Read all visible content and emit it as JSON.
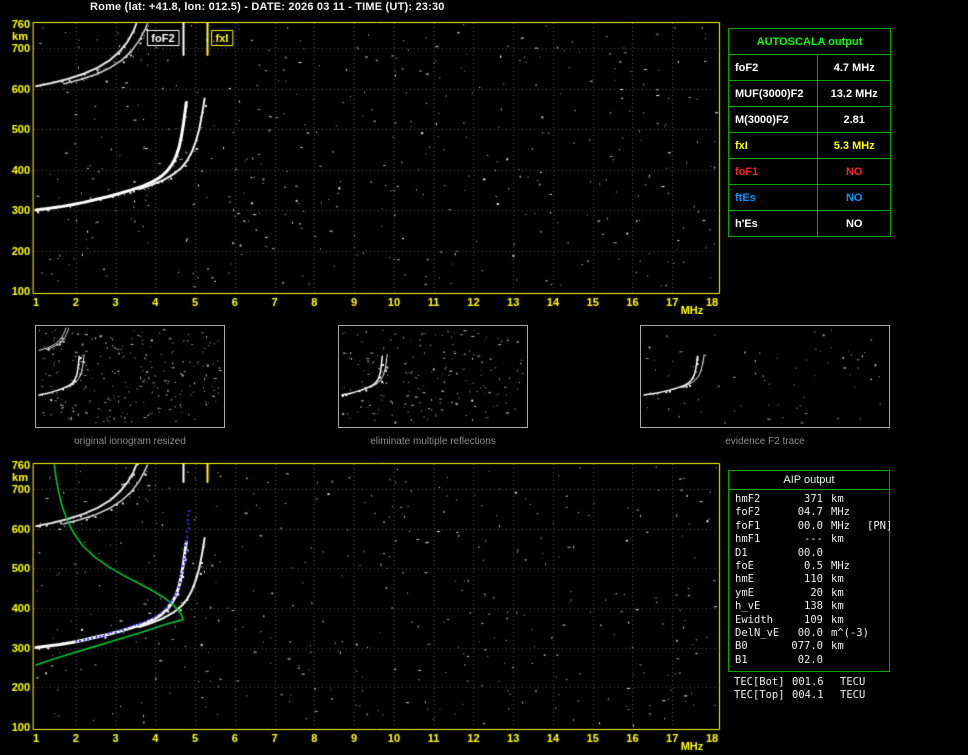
{
  "title": "Rome (lat: +41.8, lon: 012.5) - DATE: 2026 03 11 - TIME (UT): 23:30",
  "colors": {
    "background": "#000000",
    "axis": "#ffff00",
    "plot_border": "#ffff00",
    "grid": "#4f4f4f",
    "trace": "#ffffff",
    "profile_green": "#00c432",
    "fit_blue": "#3333e6",
    "table_border": "#00a800",
    "header_green": "#00ff00",
    "caption_gray": "#8c8c8c"
  },
  "autoscala_table": {
    "header": "AUTOSCALA output",
    "rows": [
      {
        "label": "foF2",
        "value": "4.7 MHz",
        "color": "#ffffff"
      },
      {
        "label": "MUF(3000)F2",
        "value": "13.2 MHz",
        "color": "#ffffff"
      },
      {
        "label": "M(3000)F2",
        "value": "2.81",
        "color": "#ffffff"
      },
      {
        "label": "fxI",
        "value": "5.3 MHz",
        "color": "#ffff00"
      },
      {
        "label": "foF1",
        "value": "NO",
        "color": "#ff2020"
      },
      {
        "label": "ftEs",
        "value": "NO",
        "color": "#0096ff"
      },
      {
        "label": "h'Es",
        "value": "NO",
        "color": "#ffffff"
      }
    ]
  },
  "aip_table": {
    "header": "AIP output",
    "rows": [
      {
        "label": "hmF2",
        "value": "371",
        "unit": "km",
        "extra": ""
      },
      {
        "label": "foF2",
        "value": "04.7",
        "unit": "MHz",
        "extra": ""
      },
      {
        "label": "foF1",
        "value": "00.0",
        "unit": "MHz",
        "extra": "[PN]"
      },
      {
        "label": "hmF1",
        "value": "---",
        "unit": "km",
        "extra": ""
      },
      {
        "label": "D1",
        "value": "00.0",
        "unit": "",
        "extra": ""
      },
      {
        "label": "foE",
        "value": "0.5",
        "unit": "MHz",
        "extra": ""
      },
      {
        "label": "hmE",
        "value": "110",
        "unit": "km",
        "extra": ""
      },
      {
        "label": "ymE",
        "value": "20",
        "unit": "km",
        "extra": ""
      },
      {
        "label": "h_vE",
        "value": "138",
        "unit": "km",
        "extra": ""
      },
      {
        "label": "Ewidth",
        "value": "109",
        "unit": "km",
        "extra": ""
      },
      {
        "label": "DelN_vE",
        "value": "00.0",
        "unit": "m^(-3)",
        "extra": ""
      },
      {
        "label": "B0",
        "value": "077.0",
        "unit": "km",
        "extra": ""
      },
      {
        "label": "B1",
        "value": "02.0",
        "unit": "",
        "extra": ""
      }
    ],
    "tec_rows": [
      {
        "label": "TEC[Bot]",
        "value": "001.6",
        "unit": "TECU"
      },
      {
        "label": "TEC[Top]",
        "value": "004.1",
        "unit": "TECU"
      }
    ]
  },
  "thumbnails": [
    {
      "caption": "original ionogram resized",
      "series_indices": [
        0,
        1,
        2,
        3
      ],
      "noise_count": 260,
      "noise_seed": 21
    },
    {
      "caption": "eliminate multiple reflections",
      "series_indices": [
        0,
        1
      ],
      "noise_count": 190,
      "noise_seed": 22
    },
    {
      "caption": "evidence F2 trace",
      "series_indices": [
        0,
        1
      ],
      "noise_count": 70,
      "noise_seed": 23
    }
  ],
  "chart_data": [
    {
      "type": "scatter",
      "title": "ionogram with autoscaled characteristics",
      "xlabel": "MHz",
      "ylabel": "km",
      "xlim": [
        1,
        18
      ],
      "ylim": [
        100,
        760
      ],
      "xticks": [
        1,
        2,
        3,
        4,
        5,
        6,
        7,
        8,
        9,
        10,
        11,
        12,
        13,
        14,
        15,
        16,
        17,
        18
      ],
      "yticks": [
        100,
        200,
        300,
        400,
        500,
        600,
        700,
        760
      ],
      "grid": true,
      "legend": false,
      "markers": [
        {
          "label": "foF2",
          "x": 4.7,
          "color": "#ffffff",
          "side": "left"
        },
        {
          "label": "fxI",
          "x": 5.3,
          "color": "#ffff00",
          "side": "right"
        }
      ],
      "noise": {
        "seed": 11,
        "count": 430
      },
      "series": [
        {
          "name": "F2-trace-o-mode",
          "color": "#ffffff",
          "style": "trace",
          "width": 3,
          "points": [
            [
              1.0,
              300
            ],
            [
              1.3,
              304
            ],
            [
              1.6,
              308
            ],
            [
              1.9,
              313
            ],
            [
              2.2,
              319
            ],
            [
              2.5,
              326
            ],
            [
              2.8,
              333
            ],
            [
              3.1,
              341
            ],
            [
              3.4,
              350
            ],
            [
              3.7,
              360
            ],
            [
              3.95,
              371
            ],
            [
              4.15,
              383
            ],
            [
              4.3,
              397
            ],
            [
              4.42,
              413
            ],
            [
              4.52,
              432
            ],
            [
              4.6,
              456
            ],
            [
              4.66,
              484
            ],
            [
              4.71,
              514
            ],
            [
              4.75,
              544
            ],
            [
              4.78,
              566
            ]
          ]
        },
        {
          "name": "F2-trace-x-mode",
          "color": "#f2f2f2",
          "style": "trace",
          "width": 2,
          "points": [
            [
              3.6,
              352
            ],
            [
              3.9,
              362
            ],
            [
              4.2,
              374
            ],
            [
              4.45,
              388
            ],
            [
              4.65,
              404
            ],
            [
              4.8,
              422
            ],
            [
              4.92,
              444
            ],
            [
              5.02,
              470
            ],
            [
              5.1,
              498
            ],
            [
              5.16,
              528
            ],
            [
              5.21,
              556
            ],
            [
              5.24,
              576
            ]
          ]
        },
        {
          "name": "second-hop-trace",
          "color": "#e6e6e6",
          "style": "trace",
          "width": 2,
          "points": [
            [
              1.0,
              606
            ],
            [
              1.4,
              614
            ],
            [
              1.8,
              624
            ],
            [
              2.2,
              637
            ],
            [
              2.55,
              652
            ],
            [
              2.85,
              670
            ],
            [
              3.1,
              692
            ],
            [
              3.3,
              716
            ],
            [
              3.45,
              742
            ],
            [
              3.52,
              760
            ]
          ]
        },
        {
          "name": "second-hop-trace-x",
          "color": "#d8d8d8",
          "style": "trace",
          "width": 1.5,
          "points": [
            [
              1.7,
              612
            ],
            [
              2.1,
              622
            ],
            [
              2.5,
              635
            ],
            [
              2.85,
              651
            ],
            [
              3.15,
              670
            ],
            [
              3.4,
              693
            ],
            [
              3.6,
              720
            ],
            [
              3.75,
              748
            ],
            [
              3.8,
              760
            ]
          ]
        }
      ]
    },
    {
      "type": "scatter",
      "title": "restored ionogram with electron density profile and fitted F2 trace",
      "xlabel": "MHz",
      "ylabel": "km",
      "xlim": [
        1,
        18
      ],
      "ylim": [
        100,
        760
      ],
      "xticks": [
        1,
        2,
        3,
        4,
        5,
        6,
        7,
        8,
        9,
        10,
        11,
        12,
        13,
        14,
        15,
        16,
        17,
        18
      ],
      "yticks": [
        100,
        200,
        300,
        400,
        500,
        600,
        700,
        760
      ],
      "grid": true,
      "legend": false,
      "markers": [
        {
          "label": "",
          "x": 4.7,
          "color": "#ffffff",
          "side": "left"
        },
        {
          "label": "",
          "x": 5.3,
          "color": "#ffff00",
          "side": "right"
        }
      ],
      "noise": {
        "seed": 17,
        "count": 400
      },
      "series": [
        {
          "name": "F2-trace-o-mode",
          "color": "#ffffff",
          "style": "trace",
          "width": 3,
          "points": [
            [
              1.0,
              300
            ],
            [
              1.3,
              304
            ],
            [
              1.6,
              308
            ],
            [
              1.9,
              313
            ],
            [
              2.2,
              319
            ],
            [
              2.5,
              326
            ],
            [
              2.8,
              333
            ],
            [
              3.1,
              341
            ],
            [
              3.4,
              350
            ],
            [
              3.7,
              360
            ],
            [
              3.95,
              371
            ],
            [
              4.15,
              383
            ],
            [
              4.3,
              397
            ],
            [
              4.42,
              413
            ],
            [
              4.52,
              432
            ],
            [
              4.6,
              456
            ],
            [
              4.66,
              484
            ],
            [
              4.71,
              514
            ],
            [
              4.75,
              544
            ],
            [
              4.78,
              566
            ]
          ]
        },
        {
          "name": "F2-trace-x-mode",
          "color": "#f2f2f2",
          "style": "trace",
          "width": 2,
          "points": [
            [
              3.6,
              352
            ],
            [
              3.9,
              362
            ],
            [
              4.2,
              374
            ],
            [
              4.45,
              388
            ],
            [
              4.65,
              404
            ],
            [
              4.8,
              422
            ],
            [
              4.92,
              444
            ],
            [
              5.02,
              470
            ],
            [
              5.1,
              498
            ],
            [
              5.16,
              528
            ],
            [
              5.21,
              556
            ],
            [
              5.24,
              576
            ]
          ]
        },
        {
          "name": "second-hop-trace",
          "color": "#e6e6e6",
          "style": "trace",
          "width": 2,
          "points": [
            [
              1.0,
              606
            ],
            [
              1.4,
              614
            ],
            [
              1.8,
              624
            ],
            [
              2.2,
              637
            ],
            [
              2.55,
              652
            ],
            [
              2.85,
              670
            ],
            [
              3.1,
              692
            ],
            [
              3.3,
              716
            ],
            [
              3.45,
              742
            ],
            [
              3.52,
              760
            ]
          ]
        },
        {
          "name": "second-hop-trace-x",
          "color": "#d8d8d8",
          "style": "trace",
          "width": 1.5,
          "points": [
            [
              1.7,
              612
            ],
            [
              2.1,
              622
            ],
            [
              2.5,
              635
            ],
            [
              2.85,
              651
            ],
            [
              3.15,
              670
            ],
            [
              3.4,
              693
            ],
            [
              3.6,
              720
            ],
            [
              3.75,
              748
            ],
            [
              3.8,
              760
            ]
          ]
        },
        {
          "name": "electron-density-profile",
          "color": "#00c432",
          "style": "line",
          "width": 1.6,
          "points": [
            [
              1.0,
              256
            ],
            [
              1.35,
              268
            ],
            [
              1.75,
              281
            ],
            [
              2.15,
              293
            ],
            [
              2.55,
              305
            ],
            [
              2.95,
              317
            ],
            [
              3.35,
              329
            ],
            [
              3.7,
              340
            ],
            [
              4.0,
              350
            ],
            [
              4.25,
              358
            ],
            [
              4.45,
              364
            ],
            [
              4.6,
              368
            ],
            [
              4.68,
              370
            ],
            [
              4.7,
              371
            ],
            [
              4.67,
              380
            ],
            [
              4.58,
              394
            ],
            [
              4.42,
              410
            ],
            [
              4.2,
              427
            ],
            [
              3.92,
              444
            ],
            [
              3.58,
              462
            ],
            [
              3.2,
              482
            ],
            [
              2.82,
              504
            ],
            [
              2.48,
              528
            ],
            [
              2.18,
              556
            ],
            [
              1.95,
              588
            ],
            [
              1.78,
              622
            ],
            [
              1.65,
              658
            ],
            [
              1.56,
              696
            ],
            [
              1.5,
              730
            ],
            [
              1.46,
              760
            ]
          ]
        },
        {
          "name": "fitted-F2-trace",
          "color": "#3333e6",
          "style": "dots",
          "width": 2,
          "points": [
            [
              2.0,
              316
            ],
            [
              2.3,
              322
            ],
            [
              2.6,
              329
            ],
            [
              2.9,
              337
            ],
            [
              3.2,
              346
            ],
            [
              3.5,
              356
            ],
            [
              3.75,
              366
            ],
            [
              3.95,
              376
            ],
            [
              4.15,
              389
            ],
            [
              4.3,
              403
            ],
            [
              4.43,
              420
            ],
            [
              4.54,
              441
            ],
            [
              4.62,
              466
            ],
            [
              4.69,
              494
            ],
            [
              4.74,
              524
            ],
            [
              4.78,
              556
            ],
            [
              4.81,
              590
            ],
            [
              4.83,
              622
            ],
            [
              4.84,
              645
            ]
          ]
        }
      ]
    }
  ]
}
